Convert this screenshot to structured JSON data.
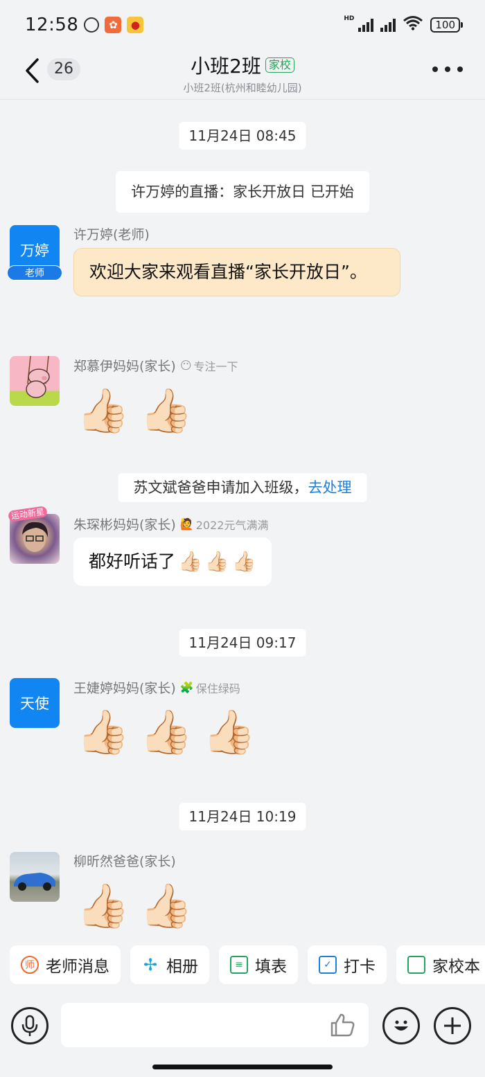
{
  "status_bar": {
    "time": "12:58",
    "hd_label": "HD",
    "battery": "100",
    "icons": [
      "alarm-icon",
      "app-icon",
      "weibo-icon",
      "signal-icon",
      "wifi-icon",
      "battery-icon"
    ]
  },
  "header": {
    "unread_count": "26",
    "title": "小班2班",
    "tag": "家校",
    "subtitle": "小班2班(杭州和睦幼儿园)"
  },
  "messages": {
    "ts1": "11月24日 08:45",
    "sys_live": "许万婷的直播：家长开放日 已开始",
    "m1": {
      "avatar_text": "万婷",
      "avatar_badge": "老师",
      "sender": "许万婷(老师)",
      "text": "欢迎大家来观看直播“家长开放日”。"
    },
    "m2": {
      "sender": "郑慕伊妈妈(家长)",
      "status_text": "专注一下",
      "thumbs": [
        "👍🏻",
        "👍🏻"
      ]
    },
    "sys_join": {
      "text": "苏文斌爸爸申请加入班级，",
      "link": "去处理"
    },
    "m3": {
      "sender": "朱琛彬妈妈(家长)",
      "status_text": "2022元气满满",
      "avatar_badge": "运动新星",
      "text": "都好听话了",
      "thumbs": [
        "👍🏻",
        "👍🏻",
        "👍🏻"
      ]
    },
    "ts2": "11月24日 09:17",
    "m4": {
      "avatar_text": "天使",
      "sender": "王婕婷妈妈(家长)",
      "status_text": "保住绿码",
      "thumbs": [
        "👍🏻",
        "👍🏻",
        "👍🏻"
      ]
    },
    "ts3": "11月24日 10:19",
    "m5": {
      "sender": "柳昕然爸爸(家长)",
      "thumbs": [
        "👍🏻",
        "👍🏻"
      ]
    }
  },
  "quick_actions": [
    {
      "label": "老师消息",
      "icon": "teacher-icon",
      "color": "#f0662c"
    },
    {
      "label": "相册",
      "icon": "pinwheel-icon",
      "color": "#16a3d8"
    },
    {
      "label": "填表",
      "icon": "form-icon",
      "color": "#22a55a"
    },
    {
      "label": "打卡",
      "icon": "checkin-icon",
      "color": "#1a7fe0"
    },
    {
      "label": "家校本",
      "icon": "notebook-icon",
      "color": "#22a55a"
    }
  ],
  "input": {
    "placeholder": ""
  }
}
